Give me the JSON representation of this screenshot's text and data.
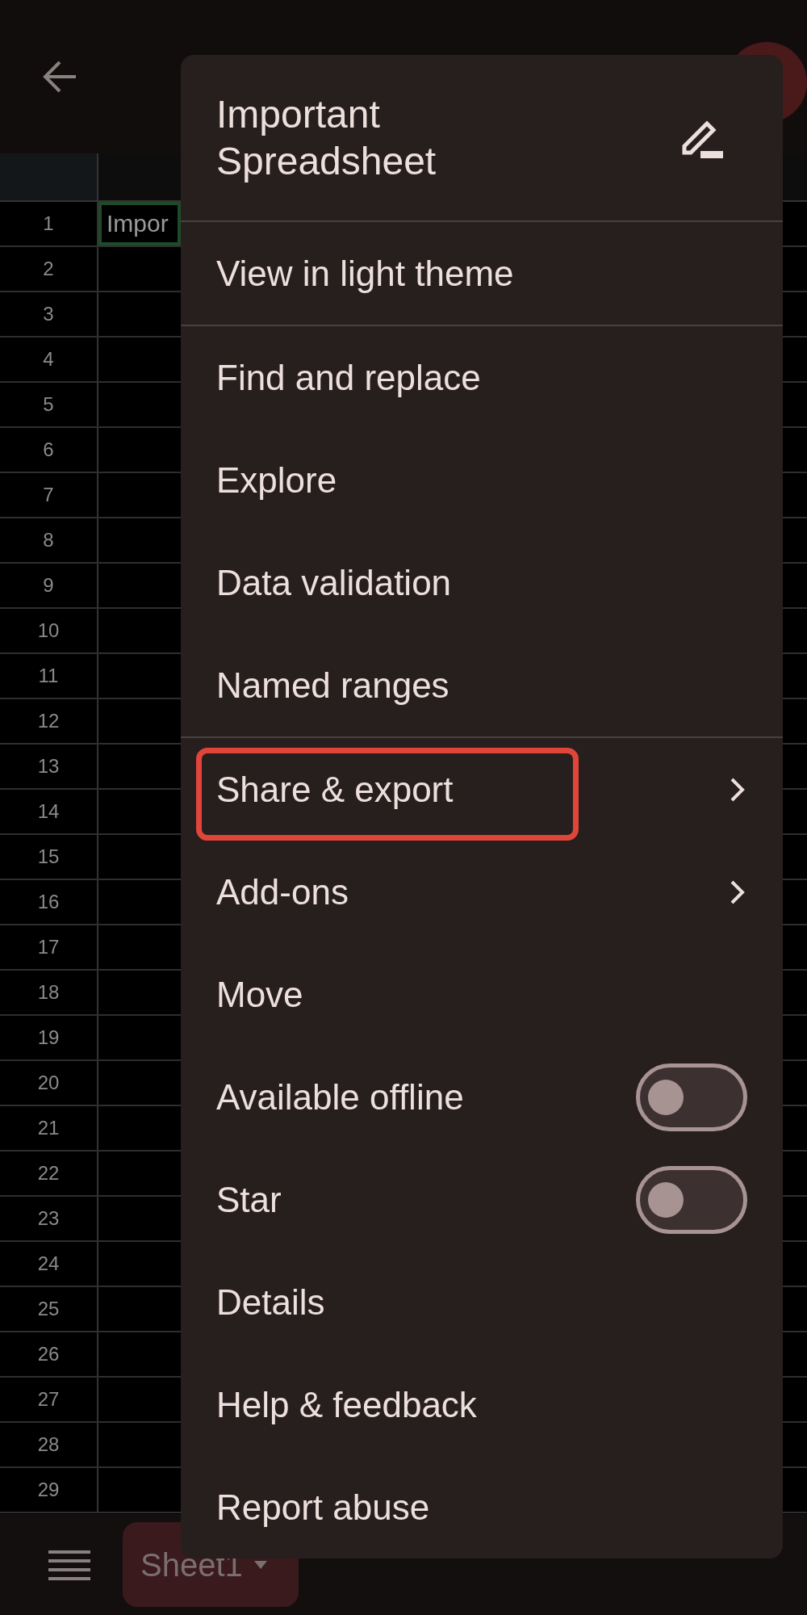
{
  "grid": {
    "rows": [
      {
        "number": "1",
        "cell": "Impor"
      },
      {
        "number": "2"
      },
      {
        "number": "3"
      },
      {
        "number": "4"
      },
      {
        "number": "5"
      },
      {
        "number": "6"
      },
      {
        "number": "7"
      },
      {
        "number": "8"
      },
      {
        "number": "9"
      },
      {
        "number": "10"
      },
      {
        "number": "11"
      },
      {
        "number": "12"
      },
      {
        "number": "13"
      },
      {
        "number": "14"
      },
      {
        "number": "15"
      },
      {
        "number": "16"
      },
      {
        "number": "17"
      },
      {
        "number": "18"
      },
      {
        "number": "19"
      },
      {
        "number": "20"
      },
      {
        "number": "21"
      },
      {
        "number": "22"
      },
      {
        "number": "23"
      },
      {
        "number": "24"
      },
      {
        "number": "25"
      },
      {
        "number": "26"
      },
      {
        "number": "27"
      },
      {
        "number": "28"
      },
      {
        "number": "29"
      }
    ]
  },
  "bottom_bar": {
    "sheet_tab": "Sheet1"
  },
  "menu": {
    "title": "Important Spreadsheet",
    "sections": [
      [
        {
          "label": "View in light theme",
          "kind": "plain",
          "highlighted": false
        }
      ],
      [
        {
          "label": "Find and replace",
          "kind": "plain",
          "highlighted": false
        },
        {
          "label": "Explore",
          "kind": "plain",
          "highlighted": false
        },
        {
          "label": "Data validation",
          "kind": "plain",
          "highlighted": false
        },
        {
          "label": "Named ranges",
          "kind": "plain",
          "highlighted": false
        }
      ],
      [
        {
          "label": "Share & export",
          "kind": "submenu",
          "highlighted": true
        },
        {
          "label": "Add-ons",
          "kind": "submenu",
          "highlighted": false
        },
        {
          "label": "Move",
          "kind": "plain",
          "highlighted": false
        },
        {
          "label": "Available offline",
          "kind": "toggle",
          "on": false,
          "highlighted": false
        },
        {
          "label": "Star",
          "kind": "toggle",
          "on": false,
          "highlighted": false
        },
        {
          "label": "Details",
          "kind": "plain",
          "highlighted": false
        },
        {
          "label": "Help & feedback",
          "kind": "plain",
          "highlighted": false
        },
        {
          "label": "Report abuse",
          "kind": "plain",
          "highlighted": false
        }
      ]
    ]
  }
}
